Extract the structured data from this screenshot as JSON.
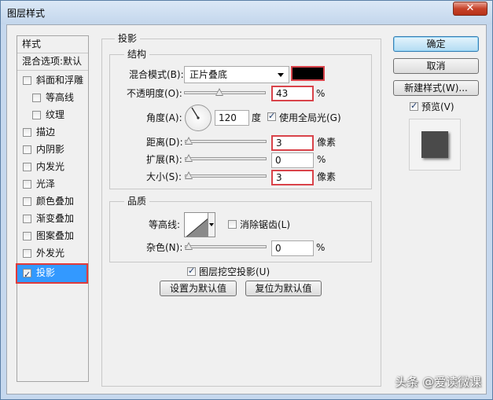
{
  "window": {
    "title": "图层样式",
    "close": "✕"
  },
  "style_list": {
    "header": "样式",
    "blend_default": "混合选项:默认",
    "items": [
      {
        "label": "斜面和浮雕",
        "checked": false
      },
      {
        "label": "等高线",
        "checked": false
      },
      {
        "label": "纹理",
        "checked": false
      },
      {
        "label": "描边",
        "checked": false
      },
      {
        "label": "内阴影",
        "checked": false
      },
      {
        "label": "内发光",
        "checked": false
      },
      {
        "label": "光泽",
        "checked": false
      },
      {
        "label": "颜色叠加",
        "checked": false
      },
      {
        "label": "渐变叠加",
        "checked": false
      },
      {
        "label": "图案叠加",
        "checked": false
      },
      {
        "label": "外发光",
        "checked": false
      },
      {
        "label": "投影",
        "checked": true
      }
    ]
  },
  "drop_shadow": {
    "title": "投影",
    "structure": {
      "title": "结构",
      "blend_mode_label": "混合模式(B):",
      "blend_mode_value": "正片叠底",
      "shadow_color": "#000000",
      "opacity_label": "不透明度(O):",
      "opacity_value": "43",
      "opacity_unit": "%",
      "angle_label": "角度(A):",
      "angle_value": "120",
      "angle_unit": "度",
      "global_light_label": "使用全局光(G)",
      "global_light_checked": true,
      "distance_label": "距离(D):",
      "distance_value": "3",
      "distance_unit": "像素",
      "spread_label": "扩展(R):",
      "spread_value": "0",
      "spread_unit": "%",
      "size_label": "大小(S):",
      "size_value": "3",
      "size_unit": "像素"
    },
    "quality": {
      "title": "品质",
      "contour_label": "等高线:",
      "antialias_label": "消除锯齿(L)",
      "antialias_checked": false,
      "noise_label": "杂色(N):",
      "noise_value": "0",
      "noise_unit": "%"
    },
    "knockout_label": "图层挖空投影(U)",
    "knockout_checked": true,
    "make_default": "设置为默认值",
    "reset_default": "复位为默认值"
  },
  "buttons": {
    "ok": "确定",
    "cancel": "取消",
    "new_style": "新建样式(W)...",
    "preview_label": "预览(V)",
    "preview_checked": true
  },
  "watermark": "头条 @爱读微课"
}
